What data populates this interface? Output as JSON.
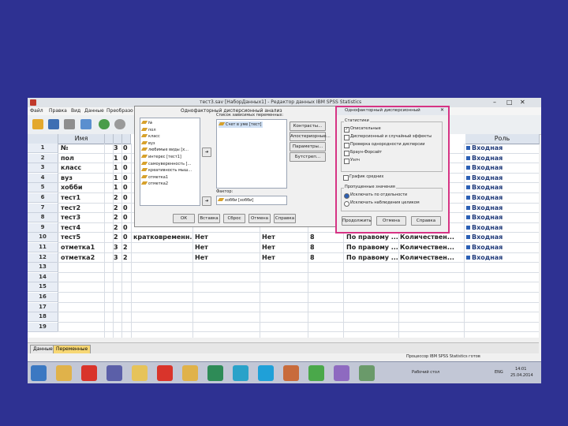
{
  "window_title": "тест3.sav [НаборДанных1] - Редактор данных IBM SPSS Statistics",
  "menu": [
    "Файл",
    "Правка",
    "Вид",
    "Данные",
    "Преобразо"
  ],
  "toolbar_icons": [
    "open-icon",
    "save-icon",
    "print-icon",
    "dialog-recall-icon",
    "undo-icon",
    "redo-icon"
  ],
  "columns": {
    "name": "Имя",
    "role": "Роль"
  },
  "rows": [
    {
      "n": "1",
      "name": "№",
      "c1": "3",
      "c2": "0",
      "label": "",
      "values": "",
      "missing": "",
      "cols": "",
      "align": "",
      "measure": "",
      "role": "Входная"
    },
    {
      "n": "2",
      "name": "пол",
      "c1": "1",
      "c2": "0",
      "label": "",
      "values": "",
      "missing": "",
      "cols": "",
      "align": "",
      "measure": "",
      "role": "Входная"
    },
    {
      "n": "3",
      "name": "класс",
      "c1": "1",
      "c2": "0",
      "label": "",
      "values": "",
      "missing": "",
      "cols": "",
      "align": "",
      "measure": "",
      "role": "Входная"
    },
    {
      "n": "4",
      "name": "вуз",
      "c1": "1",
      "c2": "0",
      "label": "",
      "values": "",
      "missing": "",
      "cols": "",
      "align": "",
      "measure": "",
      "role": "Входная"
    },
    {
      "n": "5",
      "name": "хобби",
      "c1": "1",
      "c2": "0",
      "label": "",
      "values": "",
      "missing": "",
      "cols": "",
      "align": "",
      "measure": "",
      "role": "Входная"
    },
    {
      "n": "6",
      "name": "тест1",
      "c1": "2",
      "c2": "0",
      "label": "",
      "values": "",
      "missing": "",
      "cols": "",
      "align": "",
      "measure": "",
      "role": "Входная"
    },
    {
      "n": "7",
      "name": "тест2",
      "c1": "2",
      "c2": "0",
      "label": "",
      "values": "",
      "missing": "",
      "cols": "",
      "align": "",
      "measure": "",
      "role": "Входная"
    },
    {
      "n": "8",
      "name": "тест3",
      "c1": "2",
      "c2": "0",
      "label": "",
      "values": "",
      "missing": "",
      "cols": "",
      "align": "",
      "measure": "",
      "role": "Входная"
    },
    {
      "n": "9",
      "name": "тест4",
      "c1": "2",
      "c2": "0",
      "label": "",
      "values": "",
      "missing": "",
      "cols": "",
      "align": "",
      "measure": "",
      "role": "Входная"
    },
    {
      "n": "10",
      "name": "тест5",
      "c1": "2",
      "c2": "0",
      "label": "кратковременн...",
      "values": "Нет",
      "missing": "Нет",
      "cols": "8",
      "align": "По правому ...",
      "measure": "Количествен...",
      "role": "Входная"
    },
    {
      "n": "11",
      "name": "отметка1",
      "c1": "3",
      "c2": "2",
      "label": "",
      "values": "Нет",
      "missing": "Нет",
      "cols": "8",
      "align": "По правому ...",
      "measure": "Количествен...",
      "role": "Входная"
    },
    {
      "n": "12",
      "name": "отметка2",
      "c1": "3",
      "c2": "2",
      "label": "",
      "values": "Нет",
      "missing": "Нет",
      "cols": "8",
      "align": "По правому ...",
      "measure": "Количествен...",
      "role": "Входная"
    },
    {
      "n": "13"
    },
    {
      "n": "14"
    },
    {
      "n": "15"
    },
    {
      "n": "16"
    },
    {
      "n": "17"
    },
    {
      "n": "18"
    },
    {
      "n": "19"
    }
  ],
  "tabs": {
    "data": "Данные",
    "variables": "Переменные"
  },
  "status_text": "Процессор IBM SPSS Statistics готов",
  "dialog1": {
    "title": "Однофакторный дисперсионный анализ",
    "vars": [
      "№",
      "пол",
      "класс",
      "вуз",
      "любимые виды [х...",
      "интерес [тест1]",
      "самоуверенность [...",
      "креативность мыш...",
      "отметка1",
      "отметка2"
    ],
    "dependent_label": "Список зависимых переменных:",
    "dependent_item": "Счет в уме [тест]",
    "factor_label": "Фактор:",
    "factor_item": "хобби [хобби]",
    "side_buttons": [
      "Контрасты...",
      "Апостериорные...",
      "Параметры...",
      "Бутстреп..."
    ],
    "bottom_buttons": [
      "ОК",
      "Вставка",
      "Сброс",
      "Отмена",
      "Справка"
    ]
  },
  "dialog2": {
    "title": "Однофакторный дисперсионный",
    "group1_title": "Статистики",
    "checks": [
      {
        "label": "Описательные",
        "checked": true
      },
      {
        "label": "Дисперсионный и случайный эффекты",
        "checked": false
      },
      {
        "label": "Проверка однородности дисперсии",
        "checked": false
      },
      {
        "label": "Браун-Форсайт",
        "checked": false
      },
      {
        "label": "Уэлч",
        "checked": false
      }
    ],
    "plot_label": "График средних",
    "group2_title": "Пропущенные значения",
    "radios": [
      {
        "label": "Исключать по отдельности",
        "selected": true
      },
      {
        "label": "Исключать наблюдения целиком",
        "selected": false
      }
    ],
    "buttons": [
      "Продолжить",
      "Отмена",
      "Справка"
    ]
  },
  "taskbar": {
    "icons": [
      "ie-icon",
      "explorer-icon",
      "yandex-icon",
      "spss-icon",
      "folder-icon",
      "yandex-icon",
      "paint-icon",
      "excel-icon",
      "media-icon",
      "skype-icon",
      "picture-icon",
      "chrome-icon",
      "archive-icon",
      "viewer-icon"
    ],
    "tray_text": "Рабочий стол",
    "lang": "ENG",
    "time": "14:01",
    "date": "25.04.2014"
  },
  "colors": {
    "desktop": "#2e3192",
    "highlight": "#d63384",
    "taskbar": "#c2c7d6"
  }
}
